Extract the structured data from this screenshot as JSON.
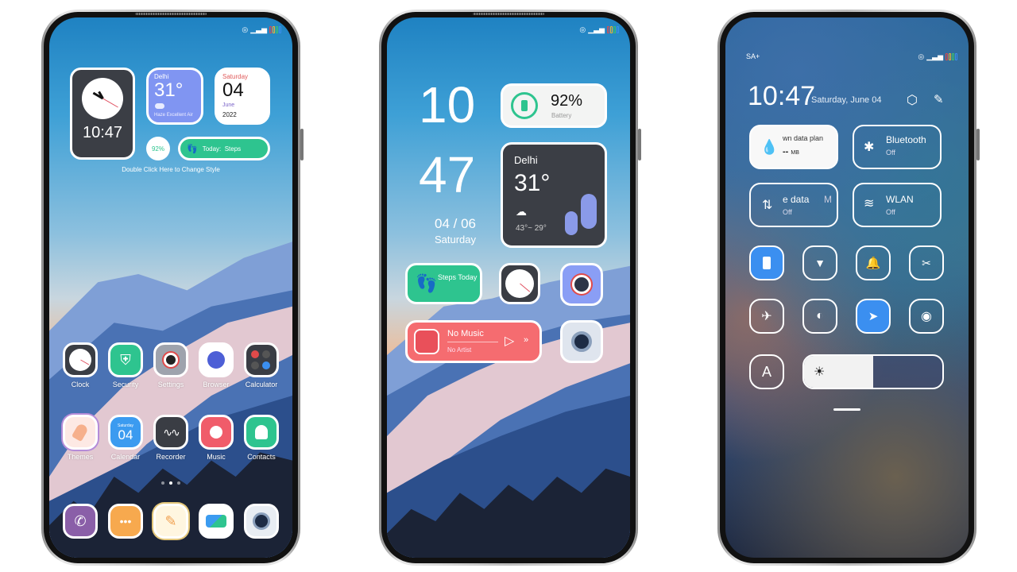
{
  "phone1": {
    "status_bar": {
      "icons": [
        "alarm-icon",
        "signal-icon",
        "battery-icon"
      ],
      "battery_colors": [
        "#e04a4a",
        "#f0b430",
        "#3cc46c",
        "#3b8ff0"
      ]
    },
    "clock_widget": {
      "time": "10:47"
    },
    "weather_widget": {
      "city": "Delhi",
      "temp": "31°",
      "condition": "Haze",
      "air": "Excellent Air"
    },
    "calendar_widget": {
      "weekday": "Saturday",
      "day": "04",
      "month": "June",
      "year": "2022"
    },
    "battery_widget": {
      "value": "92%"
    },
    "steps_widget": {
      "label": "Today:  Steps"
    },
    "hint": "Double Click Here to Change Style",
    "apps_row1": [
      {
        "label": "Clock",
        "icon": "clock-icon",
        "color": "#3a3d44"
      },
      {
        "label": "Security",
        "icon": "shield-icon",
        "color": "#2ec48f"
      },
      {
        "label": "Settings",
        "icon": "gear-icon",
        "color": "#9ea3ad"
      },
      {
        "label": "Browser",
        "icon": "globe-icon",
        "color": "#ffffff"
      },
      {
        "label": "Calculator",
        "icon": "calculator-icon",
        "color": "#3a3d44"
      }
    ],
    "apps_row2": [
      {
        "label": "Themes",
        "icon": "popsicle-icon",
        "color": "#fde9e4"
      },
      {
        "label": "Calendar",
        "icon": "calendar-icon",
        "color": "#3b9bf0",
        "weekday": "Saturday",
        "day": "04"
      },
      {
        "label": "Recorder",
        "icon": "waveform-icon",
        "color": "#3a3d44"
      },
      {
        "label": "Music",
        "icon": "guitar-icon",
        "color": "#f05c6a"
      },
      {
        "label": "Contacts",
        "icon": "contact-icon",
        "color": "#2ec48f"
      }
    ],
    "page_dots": {
      "count": 3,
      "active": 2
    },
    "dock": [
      {
        "icon": "phone-icon",
        "color": "#8a5fa8"
      },
      {
        "icon": "messages-icon",
        "color": "#f7a94e"
      },
      {
        "icon": "notes-icon",
        "color": "#fff6e0"
      },
      {
        "icon": "gallery-icon",
        "color": "#ffffff"
      },
      {
        "icon": "camera-icon",
        "color": "#e8edf3"
      }
    ]
  },
  "phone2": {
    "hour": "10",
    "minute": "47",
    "date": "04 / 06",
    "weekday": "Saturday",
    "battery_widget": {
      "value": "92%",
      "label": "Battery",
      "percent": 92
    },
    "weather_widget": {
      "city": "Delhi",
      "temp": "31°",
      "range": "43°~ 29°"
    },
    "steps_widget": {
      "label": "Steps Today"
    },
    "music_widget": {
      "title": "No Music",
      "artist": "No Artist"
    }
  },
  "phone3": {
    "carrier": "SA+",
    "time": "10:47",
    "date": "Saturday, June 04",
    "tiles": [
      {
        "title": "wn data plan",
        "sub": "-- ",
        "unit": "MB",
        "icon": "water-drop-icon",
        "active": true
      },
      {
        "title": "Bluetooth",
        "sub": "Off",
        "icon": "bluetooth-icon",
        "active": false
      },
      {
        "title": "e data",
        "sub": "Off",
        "extra": "M",
        "icon": "mobile-data-icon",
        "active": false
      },
      {
        "title": "WLAN",
        "sub": "Off",
        "icon": "wifi-icon",
        "active": false
      }
    ],
    "toggles_row1": [
      {
        "icon": "vibrate-icon",
        "active": true
      },
      {
        "icon": "flashlight-icon",
        "active": false
      },
      {
        "icon": "bell-icon",
        "active": false
      },
      {
        "icon": "screenshot-icon",
        "active": false
      }
    ],
    "toggles_row2": [
      {
        "icon": "airplane-icon",
        "active": false
      },
      {
        "icon": "dark-mode-icon",
        "active": false
      },
      {
        "icon": "location-icon",
        "active": true
      },
      {
        "icon": "eye-icon",
        "active": false
      }
    ],
    "auto_brightness": "A",
    "brightness": 0.5
  }
}
